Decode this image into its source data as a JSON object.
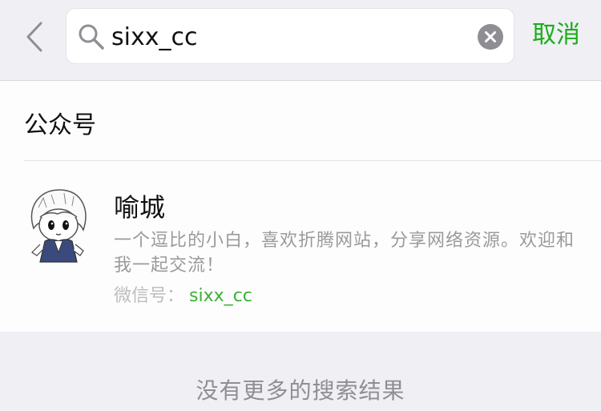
{
  "search": {
    "query": "sixx_cc",
    "cancel_label": "取消"
  },
  "section": {
    "title": "公众号"
  },
  "results": [
    {
      "name": "喻城",
      "description": "一个逗比的小白，喜欢折腾网站，分享网络资源。欢迎和我一起交流！",
      "wechat_id_label": "微信号：",
      "wechat_id": "sixx_cc"
    }
  ],
  "footer": {
    "no_more_text": "没有更多的搜索结果"
  },
  "icons": {
    "back": "chevron-left-icon",
    "search": "search-icon",
    "clear": "clear-icon"
  },
  "colors": {
    "accent": "#1aad19",
    "background": "#efeff4"
  }
}
